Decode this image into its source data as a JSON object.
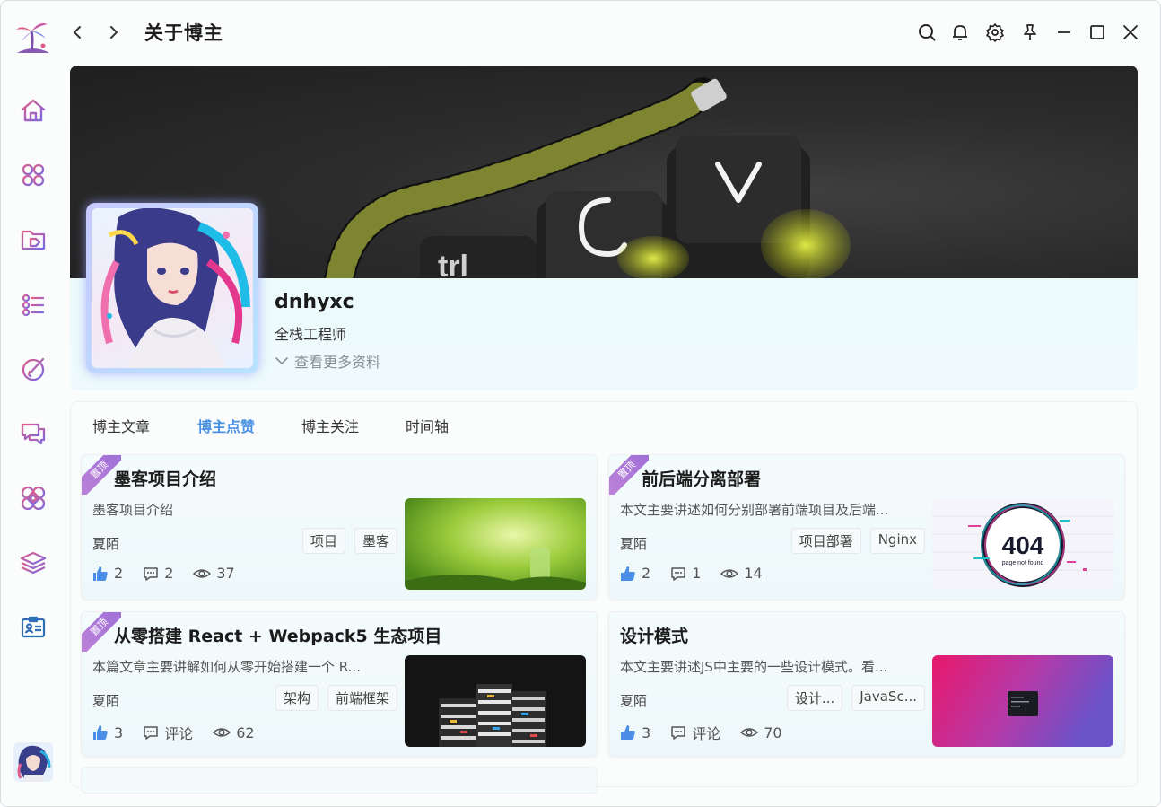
{
  "header": {
    "title": "关于博主"
  },
  "profile": {
    "username": "dnhyxc",
    "role": "全栈工程师",
    "more_info": "查看更多资料"
  },
  "tabs": [
    "博主文章",
    "博主点赞",
    "博主关注",
    "时间轴"
  ],
  "active_tab": "博主点赞",
  "sidebar": {
    "items": [
      "home-icon",
      "apps-icon",
      "folder-tag-icon",
      "list-icon",
      "paint-icon",
      "chat-icon",
      "grid-icon",
      "layers-icon",
      "id-card-icon"
    ]
  },
  "titlebar_icons": [
    "search-icon",
    "bell-icon",
    "gear-icon",
    "pin-icon",
    "minimize-icon",
    "maximize-icon",
    "close-icon"
  ],
  "colors": {
    "accent": "#4a90e2",
    "brand": "#7b5ea7"
  },
  "articles": [
    {
      "pinned": true,
      "pin_label": "置顶",
      "title": "墨客项目介绍",
      "summary": "墨客项目介绍",
      "author": "夏陌",
      "tags": [
        "项目",
        "墨客"
      ],
      "likes": "2",
      "comments": "2",
      "views": "37"
    },
    {
      "pinned": true,
      "pin_label": "置顶",
      "title": "前后端分离部署",
      "summary": "本文主要讲述如何分别部署前端项目及后端...",
      "author": "夏陌",
      "tags": [
        "项目部署",
        "Nginx"
      ],
      "likes": "2",
      "comments": "1",
      "views": "14"
    },
    {
      "pinned": true,
      "pin_label": "置顶",
      "title": "从零搭建 React + Webpack5 生态项目",
      "summary": "本篇文章主要讲解如何从零开始搭建一个 R...",
      "author": "夏陌",
      "tags": [
        "架构",
        "前端框架"
      ],
      "likes": "3",
      "comments": "评论",
      "views": "62"
    },
    {
      "pinned": false,
      "title": "设计模式",
      "summary": "本文主要讲述JS中主要的一些设计模式。看...",
      "author": "夏陌",
      "tags": [
        "设计...",
        "JavaSc..."
      ],
      "likes": "3",
      "comments": "评论",
      "views": "70"
    }
  ],
  "thumbs": {
    "notfound_code": "404",
    "notfound_caption": "page not found"
  }
}
